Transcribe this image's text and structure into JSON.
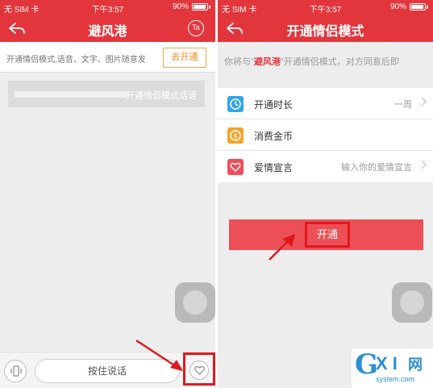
{
  "status_bar": {
    "carrier": "无 SIM 卡",
    "time": "下午3:57",
    "battery": "90%"
  },
  "left_screen": {
    "title": "避风港",
    "header_right_icon": "Ta",
    "promo_text": "开通情侣模式,语音、文字、图片随意发",
    "promo_button": "去开通",
    "chat_message": "开通情侣模式话语",
    "hold_to_talk": "按住说话",
    "icons": [
      "back-arrow-icon",
      "ta-icon",
      "voice-mode-icon",
      "heart-icon"
    ]
  },
  "right_screen": {
    "title": "开通情侣模式",
    "notice_prefix": "你将与\"",
    "notice_highlight": "避风港",
    "notice_suffix": "\"开通情侣模式，对方同意后即",
    "rows": [
      {
        "label": "开通时长",
        "value": "一周",
        "icon_color": "#2fa5e8",
        "icon": "clock-icon"
      },
      {
        "label": "消费金币",
        "value": "",
        "icon_color": "#f3a428",
        "icon": "coin-icon"
      },
      {
        "label": "爱情宣言",
        "value": "输入你的爱情宣言",
        "icon_color": "#f04e5a",
        "icon": "heart-icon"
      }
    ],
    "open_button": "开通"
  },
  "watermark": {
    "g": "G",
    "xi": "X I",
    "net": "网",
    "url": "system.com"
  },
  "colors": {
    "brand_red": "#e2363c",
    "highlight_box": "#e0181e",
    "promo_orange": "#f08a1c"
  }
}
